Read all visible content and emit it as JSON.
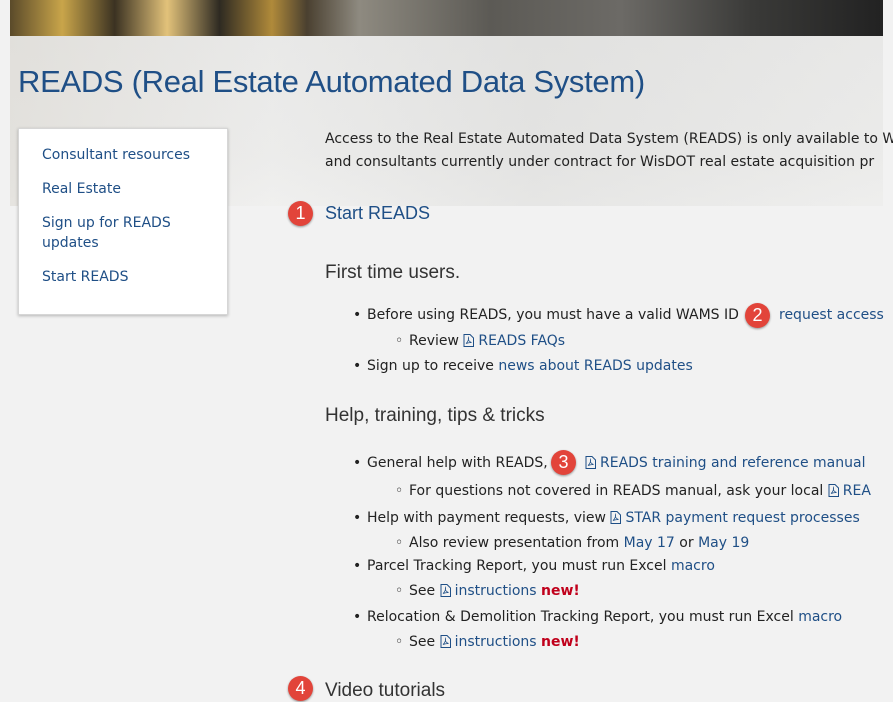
{
  "page_title": "READS (Real Estate Automated Data System)",
  "sidebar": {
    "items": [
      {
        "label": "Consultant resources"
      },
      {
        "label": "Real Estate"
      },
      {
        "label": "Sign up for READS updates"
      },
      {
        "label": "Start READS"
      }
    ]
  },
  "intro": {
    "line1": "Access to the Real Estate Automated Data System (READS) is only available to W",
    "line2": "and consultants currently under contract for WisDOT real estate acquisition pr"
  },
  "badges": [
    "1",
    "2",
    "3",
    "4"
  ],
  "start_heading": "Start READS",
  "first_time": {
    "heading": "First time users.",
    "item1_text": "Before using READS, you must have a valid WAMS ID",
    "item1_link": "request access",
    "item1a_prefix": "Review",
    "item1a_link": "READS FAQs",
    "item2_text": "Sign up to receive",
    "item2_link": "news about READS updates"
  },
  "help": {
    "heading": "Help, training, tips & tricks",
    "item1_text": "General help with READS,",
    "item1_link": "READS training and reference manual",
    "item1a_text": "For questions not covered in READS manual, ask your local",
    "item1a_link": "REA",
    "item2_text": "Help with payment requests, view",
    "item2_link": "STAR payment request processes",
    "item2a_text": "Also review presentation from",
    "item2a_link1": "May 17",
    "item2a_or": "or",
    "item2a_link2": "May 19",
    "item3_text": "Parcel Tracking Report, you must run Excel",
    "item3_link": "macro",
    "item3a_prefix": "See",
    "item3a_link": "instructions",
    "item3a_new": "new!",
    "item4_text": "Relocation & Demolition Tracking Report, you must run Excel",
    "item4_link": "macro",
    "item4a_prefix": "See",
    "item4a_link": "instructions",
    "item4a_new": "new!"
  },
  "video_heading": "Video tutorials",
  "colors": {
    "link": "#1f4f86",
    "badge": "#e2443a",
    "new": "#c0001b"
  }
}
